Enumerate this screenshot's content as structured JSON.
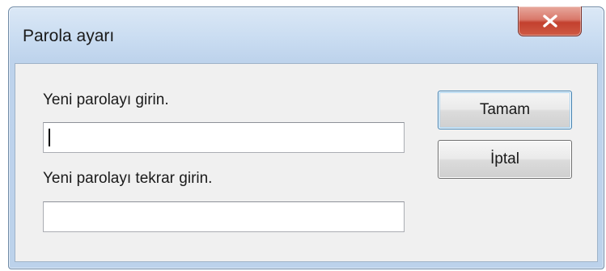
{
  "window": {
    "title": "Parola ayarı",
    "close_glyph": "x",
    "close_icon": "close-icon"
  },
  "form": {
    "new_password_label": "Yeni parolayı girin.",
    "new_password_value": "",
    "confirm_password_label": "Yeni parolayı tekrar girin.",
    "confirm_password_value": ""
  },
  "buttons": {
    "ok_label": "Tamam",
    "cancel_label": "İptal"
  },
  "colors": {
    "title_bar": "#c9dcf1",
    "close_button": "#c3402e",
    "client_background": "#f0f0f0"
  }
}
